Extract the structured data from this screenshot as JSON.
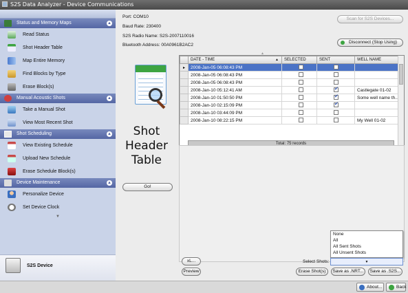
{
  "window": {
    "title": "S2S Data Analyzer - Device Communications"
  },
  "sidebar": {
    "sections": [
      {
        "title": "Status and Memory Maps",
        "items": [
          "Read Status",
          "Shot Header Table",
          "Map Entire Memory",
          "Find Blocks by Type",
          "Erase Block(s)"
        ]
      },
      {
        "title": "Manual Acoustic Shots",
        "items": [
          "Take a Manual Shot",
          "View Most Recent Shot"
        ]
      },
      {
        "title": "Shot Scheduling",
        "items": [
          "View Existing Schedule",
          "Upload New Schedule",
          "Erase Schedule Block(s)"
        ]
      },
      {
        "title": "Device Maintenance",
        "items": [
          "Personalize Device",
          "Set Device Clock"
        ]
      }
    ],
    "device_label": "S2S Device"
  },
  "connection": {
    "port": "Port: COM10",
    "baud": "Baud Rate: 230400",
    "radio": "S2S Radio Name: S2S-2007110016",
    "bluetooth": "Bluetooth Address: 00A0961B2AC2"
  },
  "buttons": {
    "scan": "Scan for S2S Devices...",
    "disconnect": "Disconnect (Stop Using)",
    "go": "Go!",
    "xl": "xL...",
    "preview": "Preview",
    "erase_shots": "Erase Shot(s)",
    "save_nrt": "Save as .NRT...",
    "save_s2s": "Save as .S2S...",
    "about": "About...",
    "back": "Back"
  },
  "panel_title": "Shot Header Table",
  "grid": {
    "columns": [
      "DATE - TIME",
      "SELECTED",
      "SENT",
      "WELL NAME"
    ],
    "rows": [
      {
        "date": "2008-Jan-05  06:08:43 PM",
        "selected": false,
        "sent": false,
        "well": "",
        "current": true
      },
      {
        "date": "2008-Jan-05  06:08:43 PM",
        "selected": false,
        "sent": false,
        "well": ""
      },
      {
        "date": "2008-Jan-05  06:08:43 PM",
        "selected": false,
        "sent": false,
        "well": ""
      },
      {
        "date": "2008-Jan-10  05:12:41 AM",
        "selected": false,
        "sent": true,
        "well": "Castlegate 01-02"
      },
      {
        "date": "2008-Jan-10  01:50:50 PM",
        "selected": false,
        "sent": true,
        "well": "Some well name th..."
      },
      {
        "date": "2008-Jan-10  02:15:09 PM",
        "selected": false,
        "sent": true,
        "well": ""
      },
      {
        "date": "2008-Jan-10  03:44:09 PM",
        "selected": false,
        "sent": false,
        "well": ""
      },
      {
        "date": "2008-Jan-10  08:22:15 PM",
        "selected": false,
        "sent": false,
        "well": "My Well 01-02"
      }
    ],
    "total": "Total: 75 records"
  },
  "select_shots": {
    "label": "Select Shots:",
    "value": "",
    "options": [
      "None",
      "All",
      "All Sent Shots",
      "All Unsent Shots"
    ]
  }
}
